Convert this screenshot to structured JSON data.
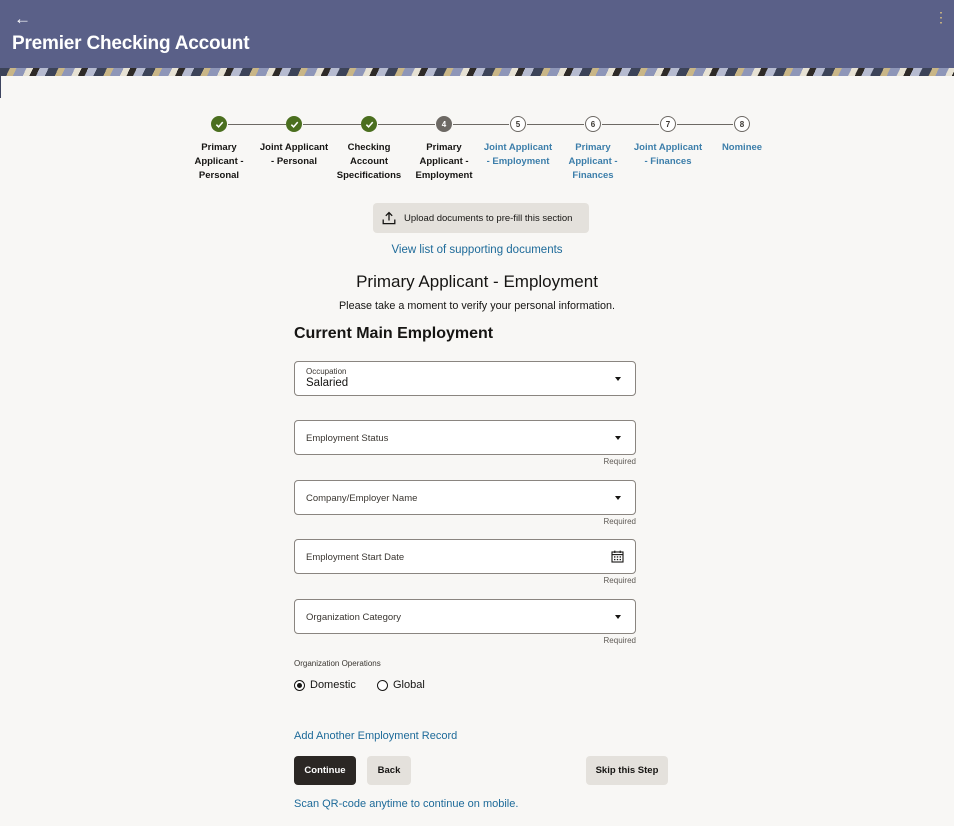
{
  "header": {
    "back_glyph": "←",
    "title": "Premier Checking Account",
    "menu_glyph": "⋮"
  },
  "stepper": {
    "steps": [
      {
        "number": "",
        "status": "done",
        "label": "Primary Applicant - Personal"
      },
      {
        "number": "",
        "status": "done",
        "label": "Joint Applicant - Personal"
      },
      {
        "number": "",
        "status": "done",
        "label": "Checking Account Specifications"
      },
      {
        "number": "4",
        "status": "current",
        "label": "Primary Applicant - Employment"
      },
      {
        "number": "5",
        "status": "upcoming",
        "label": "Joint Applicant - Employment"
      },
      {
        "number": "6",
        "status": "upcoming",
        "label": "Primary Applicant - Finances"
      },
      {
        "number": "7",
        "status": "upcoming",
        "label": "Joint Applicant - Finances"
      },
      {
        "number": "8",
        "status": "upcoming",
        "label": "Nominee"
      }
    ]
  },
  "upload": {
    "label": "Upload documents to pre-fill this section"
  },
  "view_docs_link": "View list of supporting documents",
  "page": {
    "heading": "Primary Applicant - Employment",
    "subheading": "Please take a moment to verify your personal information.",
    "section_heading": "Current Main Employment"
  },
  "form": {
    "occupation": {
      "label": "Occupation",
      "value": "Salaried"
    },
    "employment_status": {
      "label": "Employment Status",
      "hint": "Required"
    },
    "company_name": {
      "label": "Company/Employer Name",
      "hint": "Required"
    },
    "start_date": {
      "label": "Employment Start Date",
      "hint": "Required"
    },
    "organization_category": {
      "label": "Organization Category",
      "hint": "Required"
    },
    "organization_operations": {
      "label": "Organization Operations",
      "options": [
        "Domestic",
        "Global"
      ],
      "selected": "Domestic"
    }
  },
  "add_employment_link": "Add Another Employment Record",
  "buttons": {
    "continue": "Continue",
    "back": "Back",
    "skip": "Skip this Step"
  },
  "qr_link": "Scan QR-code anytime to continue on mobile.",
  "colors": {
    "header_bg": "#5a6088",
    "step_done": "#4b6f1f",
    "step_current": "#6d6964",
    "link": "#1d6a99",
    "primary_button": "#2b2724"
  }
}
